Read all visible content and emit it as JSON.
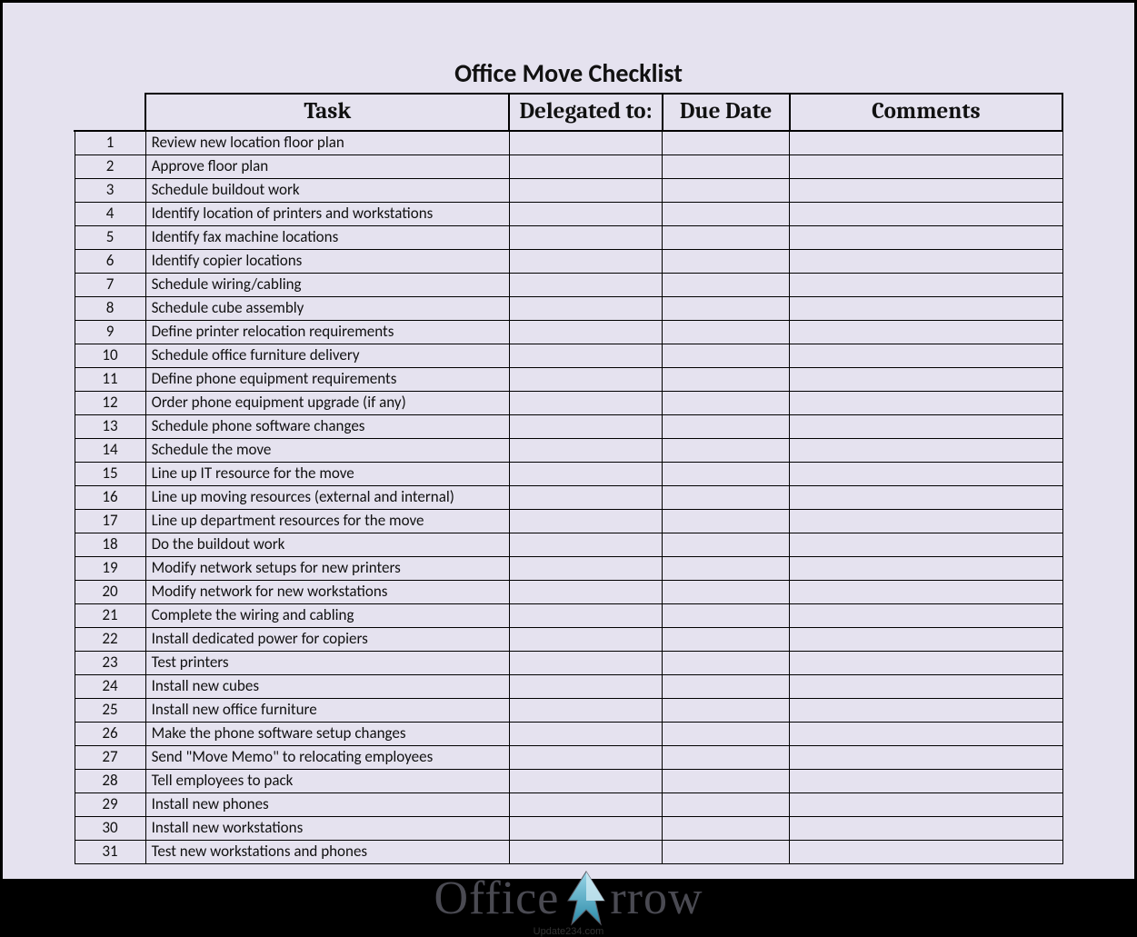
{
  "title": "Office Move Checklist",
  "headers": {
    "task": "Task",
    "delegated": "Delegated to:",
    "due": "Due Date",
    "comments": "Comments"
  },
  "rows": [
    {
      "num": "1",
      "task": "Review new location floor plan",
      "delegated": "",
      "due": "",
      "comments": ""
    },
    {
      "num": "2",
      "task": "Approve floor plan",
      "delegated": "",
      "due": "",
      "comments": ""
    },
    {
      "num": "3",
      "task": "Schedule buildout work",
      "delegated": "",
      "due": "",
      "comments": ""
    },
    {
      "num": "4",
      "task": "Identify location of printers and workstations",
      "delegated": "",
      "due": "",
      "comments": ""
    },
    {
      "num": "5",
      "task": "Identify fax machine locations",
      "delegated": "",
      "due": "",
      "comments": ""
    },
    {
      "num": "6",
      "task": "Identify copier locations",
      "delegated": "",
      "due": "",
      "comments": ""
    },
    {
      "num": "7",
      "task": "Schedule wiring/cabling",
      "delegated": "",
      "due": "",
      "comments": ""
    },
    {
      "num": "8",
      "task": "Schedule cube assembly",
      "delegated": "",
      "due": "",
      "comments": ""
    },
    {
      "num": "9",
      "task": "Define printer relocation requirements",
      "delegated": "",
      "due": "",
      "comments": ""
    },
    {
      "num": "10",
      "task": "Schedule office furniture delivery",
      "delegated": "",
      "due": "",
      "comments": ""
    },
    {
      "num": "11",
      "task": "Define phone equipment requirements",
      "delegated": "",
      "due": "",
      "comments": ""
    },
    {
      "num": "12",
      "task": "Order phone equipment upgrade (if any)",
      "delegated": "",
      "due": "",
      "comments": ""
    },
    {
      "num": "13",
      "task": "Schedule phone software changes",
      "delegated": "",
      "due": "",
      "comments": ""
    },
    {
      "num": "14",
      "task": "Schedule the move",
      "delegated": "",
      "due": "",
      "comments": ""
    },
    {
      "num": "15",
      "task": "Line up IT resource for the move",
      "delegated": "",
      "due": "",
      "comments": ""
    },
    {
      "num": "16",
      "task": "Line up moving resources (external and internal)",
      "delegated": "",
      "due": "",
      "comments": ""
    },
    {
      "num": "17",
      "task": "Line up department resources for the move",
      "delegated": "",
      "due": "",
      "comments": ""
    },
    {
      "num": "18",
      "task": "Do the buildout work",
      "delegated": "",
      "due": "",
      "comments": ""
    },
    {
      "num": "19",
      "task": "Modify network setups for new printers",
      "delegated": "",
      "due": "",
      "comments": ""
    },
    {
      "num": "20",
      "task": "Modify network for new workstations",
      "delegated": "",
      "due": "",
      "comments": ""
    },
    {
      "num": "21",
      "task": "Complete the wiring and cabling",
      "delegated": "",
      "due": "",
      "comments": ""
    },
    {
      "num": "22",
      "task": "Install dedicated power for copiers",
      "delegated": "",
      "due": "",
      "comments": ""
    },
    {
      "num": "23",
      "task": "Test printers",
      "delegated": "",
      "due": "",
      "comments": ""
    },
    {
      "num": "24",
      "task": "Install new cubes",
      "delegated": "",
      "due": "",
      "comments": ""
    },
    {
      "num": "25",
      "task": "Install new office furniture",
      "delegated": "",
      "due": "",
      "comments": ""
    },
    {
      "num": "26",
      "task": "Make the phone software setup changes",
      "delegated": "",
      "due": "",
      "comments": ""
    },
    {
      "num": "27",
      "task": "Send \"Move Memo\" to relocating employees",
      "delegated": "",
      "due": "",
      "comments": ""
    },
    {
      "num": "28",
      "task": "Tell employees to pack",
      "delegated": "",
      "due": "",
      "comments": ""
    },
    {
      "num": "29",
      "task": "Install new phones",
      "delegated": "",
      "due": "",
      "comments": ""
    },
    {
      "num": "30",
      "task": "Install new workstations",
      "delegated": "",
      "due": "",
      "comments": ""
    },
    {
      "num": "31",
      "task": "Test new workstations and phones",
      "delegated": "",
      "due": "",
      "comments": ""
    }
  ],
  "logo": {
    "word1": "Office",
    "word2": "rrow"
  },
  "footer": "Update234.com"
}
